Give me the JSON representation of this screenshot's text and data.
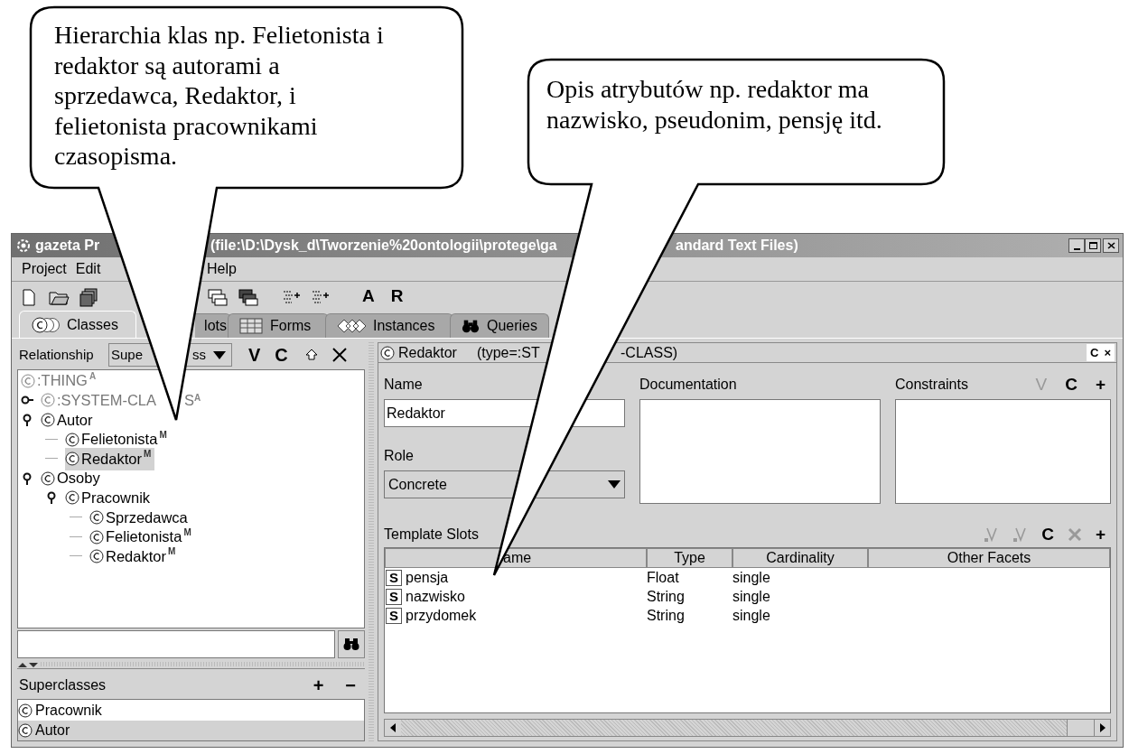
{
  "callouts": [
    {
      "lines": [
        "Hierarchia klas np. Felietonista i",
        "redaktor są autorami a",
        "sprzedawca, Redaktor, i",
        "felietonista pracownikami",
        "czasopisma."
      ]
    },
    {
      "lines": [
        "Opis atrybutów np. redaktor ma",
        "nazwisko, pseudonim, pensję itd."
      ]
    }
  ],
  "window": {
    "title_parts": [
      "gazeta Pr",
      "(file:\\D:\\Dysk_d\\Tworzenie%20ontologii\\protege\\ga",
      "andard Text Files)"
    ]
  },
  "menu": [
    "Project",
    "Edit",
    "Help"
  ],
  "toolbar_text": [
    "A",
    "R"
  ],
  "tabs": [
    {
      "label": "Classes",
      "selected": true
    },
    {
      "label": "lots",
      "selected": false
    },
    {
      "label": "Forms",
      "selected": false
    },
    {
      "label": "Instances",
      "selected": false
    },
    {
      "label": "Queries",
      "selected": false
    }
  ],
  "relationship": {
    "label": "Relationship",
    "value_parts": [
      "Supe",
      "ss"
    ],
    "buttons": [
      "V",
      "C"
    ]
  },
  "class_tree": {
    "label": ":THING",
    "badge": "A",
    "system": true,
    "selected": false,
    "children": [
      {
        "label": ":SYSTEM-CLA",
        "label_tail": "S",
        "badge": "A",
        "system": true,
        "selected": false,
        "expanded": false
      },
      {
        "label": "Autor",
        "system": false,
        "selected": false,
        "expanded": true,
        "children": [
          {
            "label": "Felietonista",
            "badge": "M",
            "system": false,
            "selected": false
          },
          {
            "label": "Redaktor",
            "badge": "M",
            "system": false,
            "selected": true
          }
        ]
      },
      {
        "label": "Osoby",
        "system": false,
        "selected": false,
        "expanded": true,
        "children": [
          {
            "label": "Pracownik",
            "system": false,
            "selected": false,
            "expanded": true,
            "children": [
              {
                "label": "Sprzedawca",
                "system": false,
                "selected": false
              },
              {
                "label": "Felietonista",
                "badge": "M",
                "system": false,
                "selected": false
              },
              {
                "label": "Redaktor",
                "badge": "M",
                "system": false,
                "selected": false
              }
            ]
          }
        ]
      }
    ]
  },
  "superclasses": {
    "title": "Superclasses",
    "buttons": [
      "+",
      "−"
    ],
    "items": [
      {
        "label": "Pracownik",
        "selected": false
      },
      {
        "label": "Autor",
        "selected": true
      }
    ]
  },
  "class_header": {
    "name": "Redaktor",
    "type_parts": [
      "(type=:ST",
      "-CLASS)"
    ],
    "buttons": [
      "C",
      "×"
    ]
  },
  "name_field": {
    "label": "Name",
    "value": "Redaktor"
  },
  "role": {
    "label": "Role",
    "value": "Concrete"
  },
  "documentation": {
    "label": "Documentation"
  },
  "constraints": {
    "label": "Constraints",
    "buttons": [
      {
        "text": "V",
        "disabled": true
      },
      {
        "text": "C",
        "disabled": false
      },
      {
        "text": "+",
        "disabled": false
      }
    ]
  },
  "template_slots": {
    "title": "Template Slots",
    "buttons": [
      {
        "kind": "icon",
        "disabled": true
      },
      {
        "kind": "icon",
        "disabled": true
      },
      {
        "kind": "text",
        "text": "C",
        "disabled": false
      },
      {
        "kind": "icon",
        "disabled": true
      },
      {
        "kind": "text",
        "text": "+",
        "disabled": false
      }
    ],
    "columns": [
      "ame",
      "Type",
      "Cardinality",
      "Other Facets"
    ],
    "rows": [
      {
        "marker": "S",
        "name": "pensja",
        "type": "Float",
        "cardinality": "single"
      },
      {
        "marker": "S",
        "name": "nazwisko",
        "type": "String",
        "cardinality": "single"
      },
      {
        "marker": "S",
        "name": "przydomek",
        "type": "String",
        "cardinality": "single"
      }
    ]
  }
}
